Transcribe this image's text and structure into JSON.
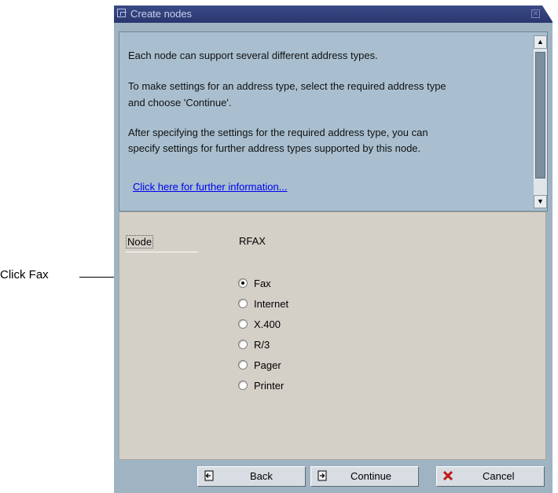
{
  "callout": {
    "text": "Click Fax"
  },
  "window": {
    "title": "Create nodes",
    "close_glyph": "✕"
  },
  "info": {
    "line1": "Each node can support several different address types.",
    "line2": "To make settings for an address type, select the required address type",
    "line3": "and choose 'Continue'.",
    "line4": "After specifying the settings for the required address type, you can",
    "line5": "specify settings for further address types supported by this node.",
    "link": "Click here for further information..."
  },
  "scrollbar": {
    "up_glyph": "▲",
    "down_glyph": "▼"
  },
  "form": {
    "node_label": "Node",
    "node_value": "RFAX",
    "options": [
      "Fax",
      "Internet",
      "X.400",
      "R/3",
      "Pager",
      "Printer"
    ],
    "selected": "Fax"
  },
  "buttons": {
    "back": "Back",
    "continue": "Continue",
    "cancel": "Cancel"
  },
  "colors": {
    "title_bar": "#2f3c78",
    "window_bg": "#9fb3c2",
    "form_bg": "#d4d0c8",
    "link": "#0000ee",
    "cancel_icon": "#c01818"
  }
}
